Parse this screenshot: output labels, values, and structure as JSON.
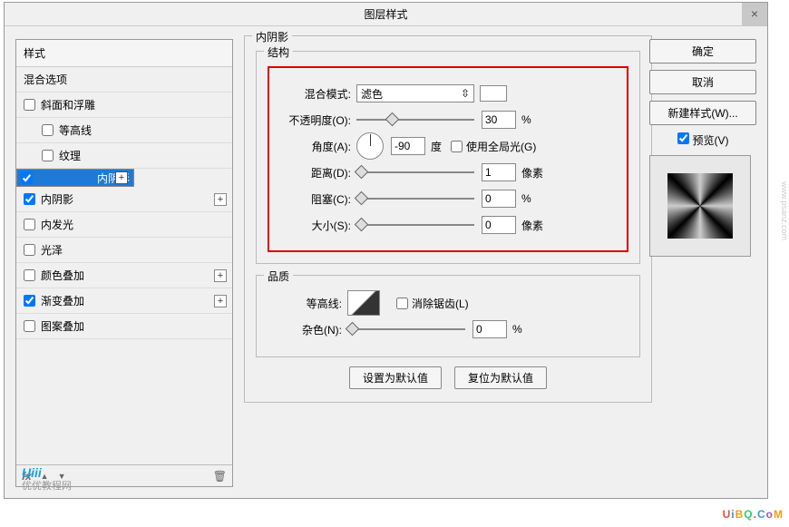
{
  "title": "图层样式",
  "sidebar": {
    "header": "样式",
    "blend_options": "混合选项",
    "items": [
      {
        "label": "斜面和浮雕",
        "checked": false,
        "indent": false
      },
      {
        "label": "等高线",
        "checked": false,
        "indent": true
      },
      {
        "label": "纹理",
        "checked": false,
        "indent": true
      },
      {
        "label": "内阴影",
        "checked": true,
        "indent": false,
        "selected": true,
        "plus": true
      },
      {
        "label": "内阴影",
        "checked": true,
        "indent": false,
        "plus": true
      },
      {
        "label": "内发光",
        "checked": false,
        "indent": false
      },
      {
        "label": "光泽",
        "checked": false,
        "indent": false
      },
      {
        "label": "颜色叠加",
        "checked": false,
        "indent": false,
        "plus": true
      },
      {
        "label": "渐变叠加",
        "checked": true,
        "indent": false,
        "plus": true
      },
      {
        "label": "图案叠加",
        "checked": false,
        "indent": false
      }
    ],
    "fx_icon": "fx",
    "up_icon": "▲",
    "down_icon": "▼",
    "trash_icon": "🗑"
  },
  "panel": {
    "section_title": "内阴影",
    "structure_title": "结构",
    "blend_mode_label": "混合模式:",
    "blend_mode_value": "滤色",
    "opacity_label": "不透明度(O):",
    "opacity_value": "30",
    "opacity_unit": "%",
    "angle_label": "角度(A):",
    "angle_value": "-90",
    "angle_unit": "度",
    "global_light_label": "使用全局光(G)",
    "distance_label": "距离(D):",
    "distance_value": "1",
    "distance_unit": "像素",
    "choke_label": "阻塞(C):",
    "choke_value": "0",
    "choke_unit": "%",
    "size_label": "大小(S):",
    "size_value": "0",
    "size_unit": "像素",
    "quality_title": "品质",
    "contour_label": "等高线:",
    "antialias_label": "消除锯齿(L)",
    "noise_label": "杂色(N):",
    "noise_value": "0",
    "noise_unit": "%",
    "default_btn": "设置为默认值",
    "reset_btn": "复位为默认值"
  },
  "right": {
    "ok": "确定",
    "cancel": "取消",
    "new_style": "新建样式(W)...",
    "preview_label": "预览(V)"
  },
  "watermark": {
    "logo": "Uiii",
    "logo_sub": "优优教程网",
    "site": "UiBQ.CoM",
    "side": "www.psanz.com"
  }
}
